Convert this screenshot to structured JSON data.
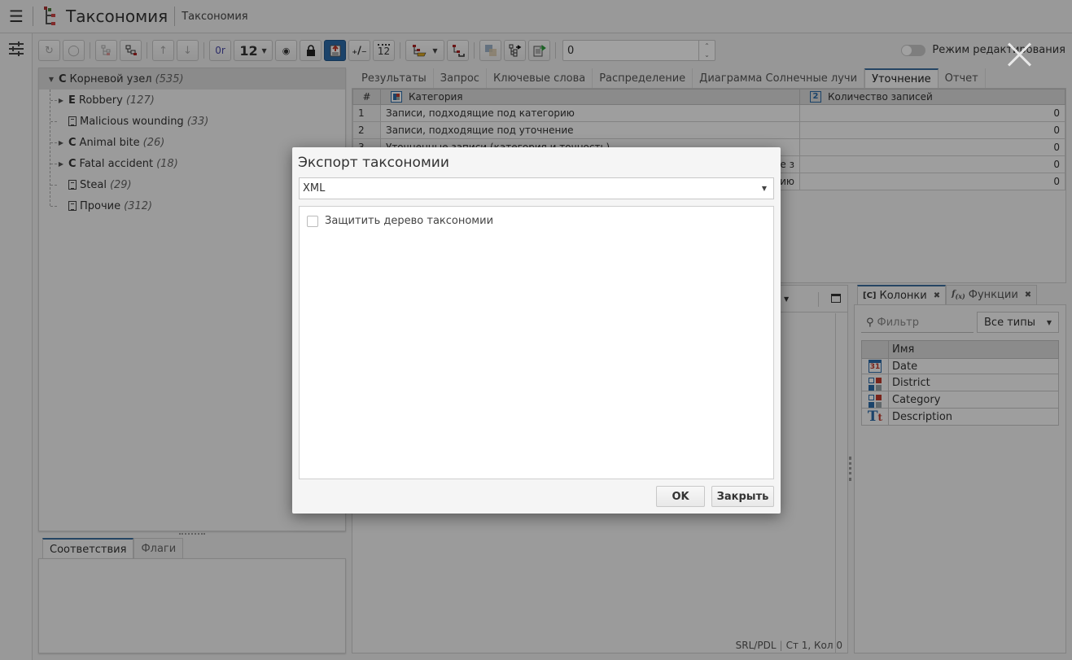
{
  "header": {
    "menu_icon": "hamburger-icon",
    "app_icon": "taxonomy-icon",
    "title": "Таксономия",
    "subtitle": "Таксономия"
  },
  "left_strip": {
    "icon": "settings-sliders-icon"
  },
  "toolbar": {
    "buttons": [
      {
        "icon": "refresh-icon",
        "enabled": false
      },
      {
        "icon": "undo-icon",
        "enabled": false
      },
      {
        "icon": "tree-expand-icon",
        "enabled": false
      },
      {
        "icon": "tree-collapse-icon",
        "enabled": true
      },
      {
        "icon": "arrow-up-icon",
        "enabled": false
      },
      {
        "icon": "arrow-down-icon",
        "enabled": false
      },
      {
        "icon": "operator-or-icon",
        "label": "Or",
        "enabled": true
      },
      {
        "icon": "eye-icon",
        "enabled": true
      },
      {
        "icon": "lock-icon",
        "enabled": true
      },
      {
        "icon": "export-icon",
        "enabled": true,
        "active": true
      },
      {
        "icon": "plus-minus-icon",
        "enabled": true
      },
      {
        "icon": "calendar-12-icon",
        "label": "12",
        "enabled": true
      },
      {
        "icon": "tree-folder-icon",
        "enabled": true
      },
      {
        "icon": "tree-bracket-icon",
        "enabled": true
      },
      {
        "icon": "merge-icon",
        "enabled": false
      },
      {
        "icon": "tree-export-icon",
        "enabled": true
      },
      {
        "icon": "document-export-icon",
        "enabled": true
      }
    ],
    "font_size_value": "12",
    "number_input_value": "0",
    "edit_mode_label": "Режим редактирования",
    "edit_mode_on": false
  },
  "tree": {
    "root": {
      "type": "C",
      "label": "Корневой узел",
      "count": "(535)"
    },
    "children": [
      {
        "type": "E",
        "label": "Robbery",
        "count": "(127)",
        "expandable": true
      },
      {
        "type": "doc",
        "label": "Malicious wounding",
        "count": "(33)",
        "expandable": false
      },
      {
        "type": "C",
        "label": "Animal bite",
        "count": "(26)",
        "expandable": true
      },
      {
        "type": "C",
        "label": "Fatal accident",
        "count": "(18)",
        "expandable": true
      },
      {
        "type": "doc",
        "label": "Steal",
        "count": "(29)",
        "expandable": false
      },
      {
        "type": "doc",
        "label": "Прочие",
        "count": "(312)",
        "expandable": false
      }
    ]
  },
  "bottom_left_tabs": [
    {
      "label": "Соответствия",
      "active": true
    },
    {
      "label": "Флаги",
      "active": false
    }
  ],
  "main_tabs": [
    {
      "label": "Результаты",
      "active": false
    },
    {
      "label": "Запрос",
      "active": false
    },
    {
      "label": "Ключевые слова",
      "active": false
    },
    {
      "label": "Распределение",
      "active": false
    },
    {
      "label": "Диаграмма Солнечные лучи",
      "active": false
    },
    {
      "label": "Уточнение",
      "active": true
    },
    {
      "label": "Отчет",
      "active": false
    }
  ],
  "results_table": {
    "headers": [
      "#",
      "Категория",
      "Количество записей"
    ],
    "rows": [
      {
        "n": "1",
        "category": "Записи, подходящие под категорию",
        "count": "0"
      },
      {
        "n": "2",
        "category": "Записи, подходящие под уточнение",
        "count": "0"
      },
      {
        "n": "3",
        "category": "Уточненные записи (категория и точность)",
        "count": "0"
      },
      {
        "n": "4",
        "category": "…щие з",
        "count": "0"
      },
      {
        "n": "5",
        "category": "…нию",
        "count": "0"
      }
    ]
  },
  "editor": {
    "status_mode": "SRL/PDL",
    "status_position": "Ст 1, Кол 0"
  },
  "columns_panel": {
    "tabs": [
      {
        "icon_label": "[C]",
        "label": "Колонки",
        "active": true
      },
      {
        "icon_label": "f(x)",
        "label": "Функции",
        "active": false
      }
    ],
    "filter_placeholder": "Фильтр",
    "type_filter": "Все типы",
    "table_header": "Имя",
    "columns": [
      {
        "name": "Date",
        "type": "date"
      },
      {
        "name": "District",
        "type": "category"
      },
      {
        "name": "Category",
        "type": "category"
      },
      {
        "name": "Description",
        "type": "text"
      }
    ]
  },
  "dialog": {
    "title": "Экспорт таксономии",
    "format": "XML",
    "protect_label": "Защитить дерево таксономии",
    "protect_checked": false,
    "ok_label": "OK",
    "close_label": "Закрыть"
  },
  "colors": {
    "accent": "#2b6aa8",
    "overlay": "rgba(0,0,0,0.37)"
  }
}
